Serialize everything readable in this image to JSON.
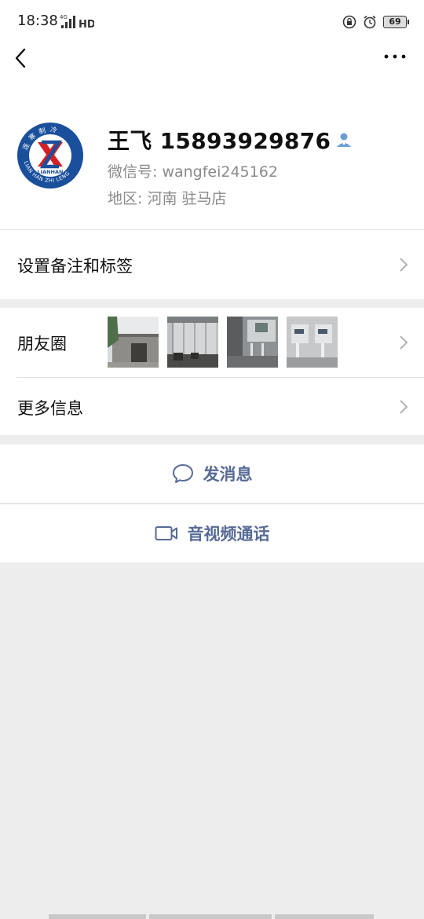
{
  "status_bar": {
    "time": "18:38",
    "network": "4G",
    "hd": "HD",
    "battery": "69"
  },
  "nav": {
    "back_icon": "chevron-left-icon",
    "more_icon": "more-dots-icon"
  },
  "profile": {
    "name": "王飞 15893929876",
    "wechat_id": "微信号:  wangfei245162",
    "region": "地区:  河南  驻马店",
    "avatar_logo": {
      "brand_cn": "连寒制冷",
      "brand_en": "LIANHAN",
      "brand_ring": "LIAN HAN ZHI LENG",
      "colors": {
        "ring": "#1a4f9c",
        "mark": "#d71f26"
      }
    }
  },
  "rows": {
    "remark": {
      "label": "设置备注和标签"
    },
    "moments": {
      "label": "朋友圈"
    },
    "more_info": {
      "label": "更多信息"
    }
  },
  "actions": {
    "message": {
      "label": "发消息",
      "icon": "chat-bubble-icon"
    },
    "video_call": {
      "label": "音视频通话",
      "icon": "video-camera-icon"
    }
  },
  "colors": {
    "link": "#576b95",
    "background": "#ededed"
  }
}
